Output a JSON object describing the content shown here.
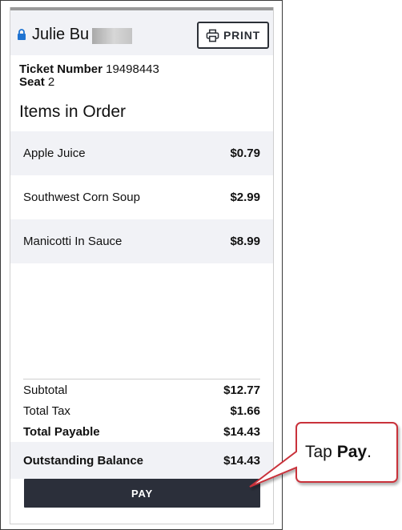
{
  "header": {
    "customer_name": "Julie Bu",
    "print_label": "PRINT"
  },
  "ticket": {
    "number_label": "Ticket Number",
    "number_value": "19498443",
    "seat_label": "Seat",
    "seat_value": "2"
  },
  "order": {
    "title": "Items in Order",
    "items": [
      {
        "name": "Apple Juice",
        "price": "$0.79"
      },
      {
        "name": "Southwest Corn Soup",
        "price": "$2.99"
      },
      {
        "name": "Manicotti In Sauce",
        "price": "$8.99"
      }
    ]
  },
  "totals": {
    "subtotal_label": "Subtotal",
    "subtotal_value": "$12.77",
    "tax_label": "Total Tax",
    "tax_value": "$1.66",
    "payable_label": "Total Payable",
    "payable_value": "$14.43",
    "outstanding_label": "Outstanding Balance",
    "outstanding_value": "$14.43"
  },
  "pay_label": "PAY",
  "callout": {
    "prefix": "Tap ",
    "emphasis": "Pay",
    "suffix": "."
  },
  "colors": {
    "accent_lock": "#1f73d1",
    "button_dark": "#2b2f3a",
    "callout_border": "#c9303a"
  },
  "icons": [
    "lock-icon",
    "printer-icon"
  ]
}
